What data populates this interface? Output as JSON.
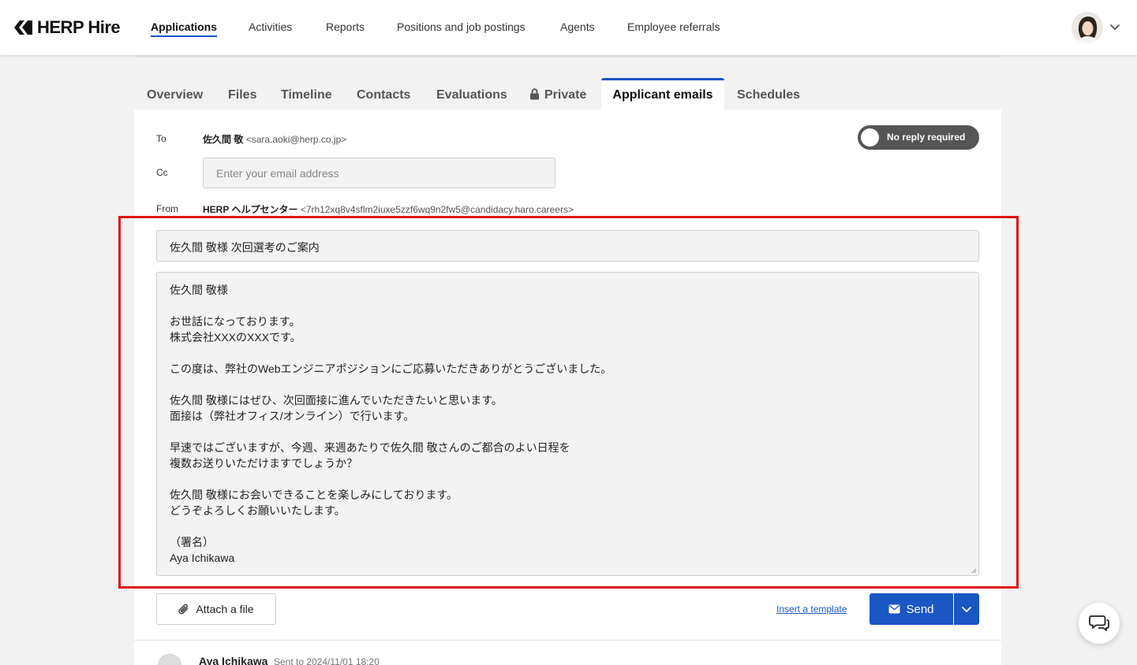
{
  "app": {
    "logo_text": "HERP Hire"
  },
  "nav": {
    "items": [
      "Applications",
      "Activities",
      "Reports",
      "Positions and job postings",
      "Agents",
      "Employee referrals"
    ],
    "active": "Applications"
  },
  "tabs": {
    "items": [
      "Overview",
      "Files",
      "Timeline",
      "Contacts",
      "Evaluations",
      "Private",
      "Applicant emails",
      "Schedules"
    ],
    "active": "Applicant emails"
  },
  "email": {
    "to_label": "To",
    "to_name": "佐久間 敬",
    "to_address": "<sara.aoki@herp.co.jp>",
    "cc_label": "Cc",
    "cc_placeholder": "Enter your email address",
    "from_label": "From",
    "from_name": "HERP ヘルプセンター",
    "from_address": "<7rh12xq8v4sflm2iuxe5zzf6wq9n2fw5@candidacy.haro.careers>",
    "no_reply_toggle": "No reply required",
    "subject": "佐久間 敬様 次回選考のご案内",
    "body_lines": [
      "佐久間 敬様",
      "",
      "お世話になっております。",
      "株式会社XXXのXXXです。",
      "",
      "この度は、弊社のWebエンジニアポジションにご応募いただきありがとうございました。",
      "",
      "佐久間 敬様にはぜひ、次回面接に進んでいただきたいと思います。",
      "面接は（弊社オフィス/オンライン）で行います。",
      "",
      "早速ではございますが、今週、来週あたりで佐久間 敬さんのご都合のよい日程を",
      "複数お送りいただけますでしょうか？",
      "",
      "佐久間 敬様にお会いできることを楽しみにしております。",
      "どうぞよろしくお願いいたします。",
      "",
      "（署名）",
      "Aya Ichikawa"
    ]
  },
  "actions": {
    "attach": "Attach a file",
    "insert_template": "Insert a template",
    "send": "Send"
  },
  "thread": {
    "sender": "Aya Ichikawa",
    "meta": "Sent to 2024/11/01 18:20"
  },
  "colors": {
    "accent": "#1a56c4",
    "highlight": "#e01414",
    "toggle_bg": "#555555"
  }
}
